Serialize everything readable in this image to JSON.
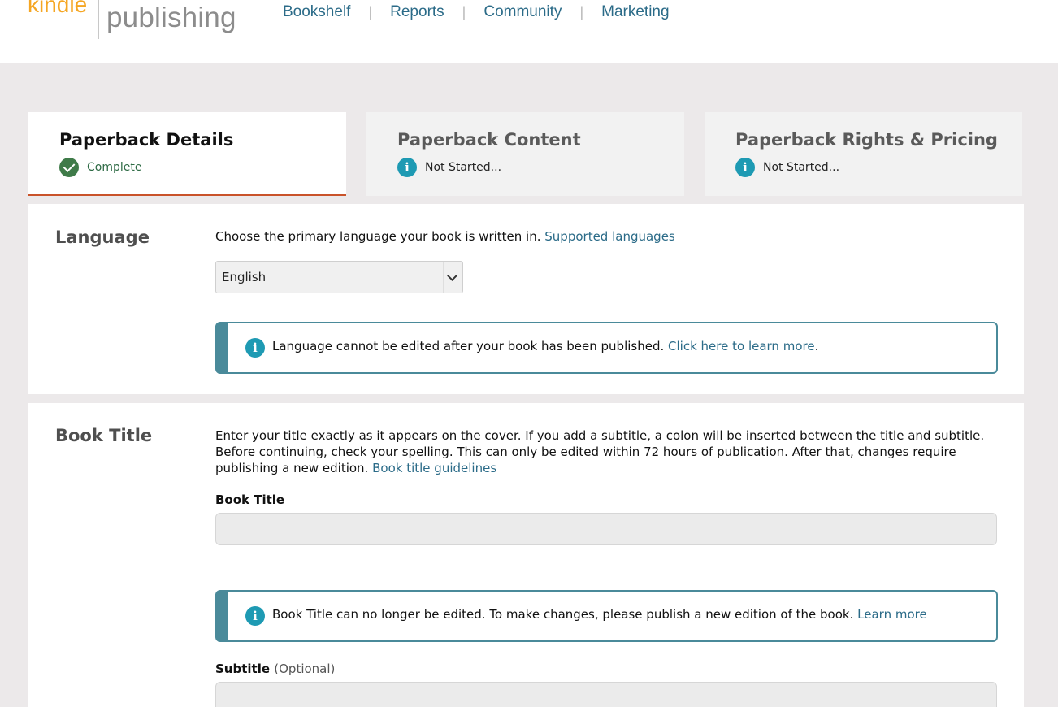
{
  "header": {
    "logo_primary": "kindle",
    "logo_secondary": "publishing",
    "nav": [
      "Bookshelf",
      "Reports",
      "Community",
      "Marketing"
    ]
  },
  "tabs": [
    {
      "title": "Paperback Details",
      "status": "Complete",
      "status_icon": "check-icon",
      "active": true
    },
    {
      "title": "Paperback Content",
      "status": "Not Started...",
      "status_icon": "info-icon",
      "active": false
    },
    {
      "title": "Paperback Rights & Pricing",
      "status": "Not Started...",
      "status_icon": "info-icon",
      "active": false
    }
  ],
  "language": {
    "heading": "Language",
    "description": "Choose the primary language your book is written in.",
    "link": "Supported languages",
    "selected": "English",
    "alert_text": "Language cannot be edited after your book has been published.",
    "alert_link": "Click here to learn more",
    "alert_suffix": "."
  },
  "book_title": {
    "heading": "Book Title",
    "description_line1": "Enter your title exactly as it appears on the cover. If you add a subtitle, a colon will be inserted between the title and subtitle.",
    "description_line2": "Before continuing, check your spelling. This can only be edited within 72 hours of publication. After that, changes require",
    "description_line3": "publishing a new edition.",
    "link": "Book title guidelines",
    "field_label": "Book Title",
    "field_value": "",
    "alert_text": "Book Title can no longer be edited. To make changes, please publish a new edition of the book.",
    "alert_link": "Learn more",
    "subtitle_label": "Subtitle",
    "subtitle_optional": "(Optional)",
    "subtitle_value": ""
  },
  "colors": {
    "accent_tab_underline": "#c9532a",
    "link": "#2b6b88",
    "alert_border": "#4a8a9a",
    "complete_green": "#3f7b49",
    "info_blue": "#1e9ab3",
    "kindle_orange": "#f5a623"
  }
}
